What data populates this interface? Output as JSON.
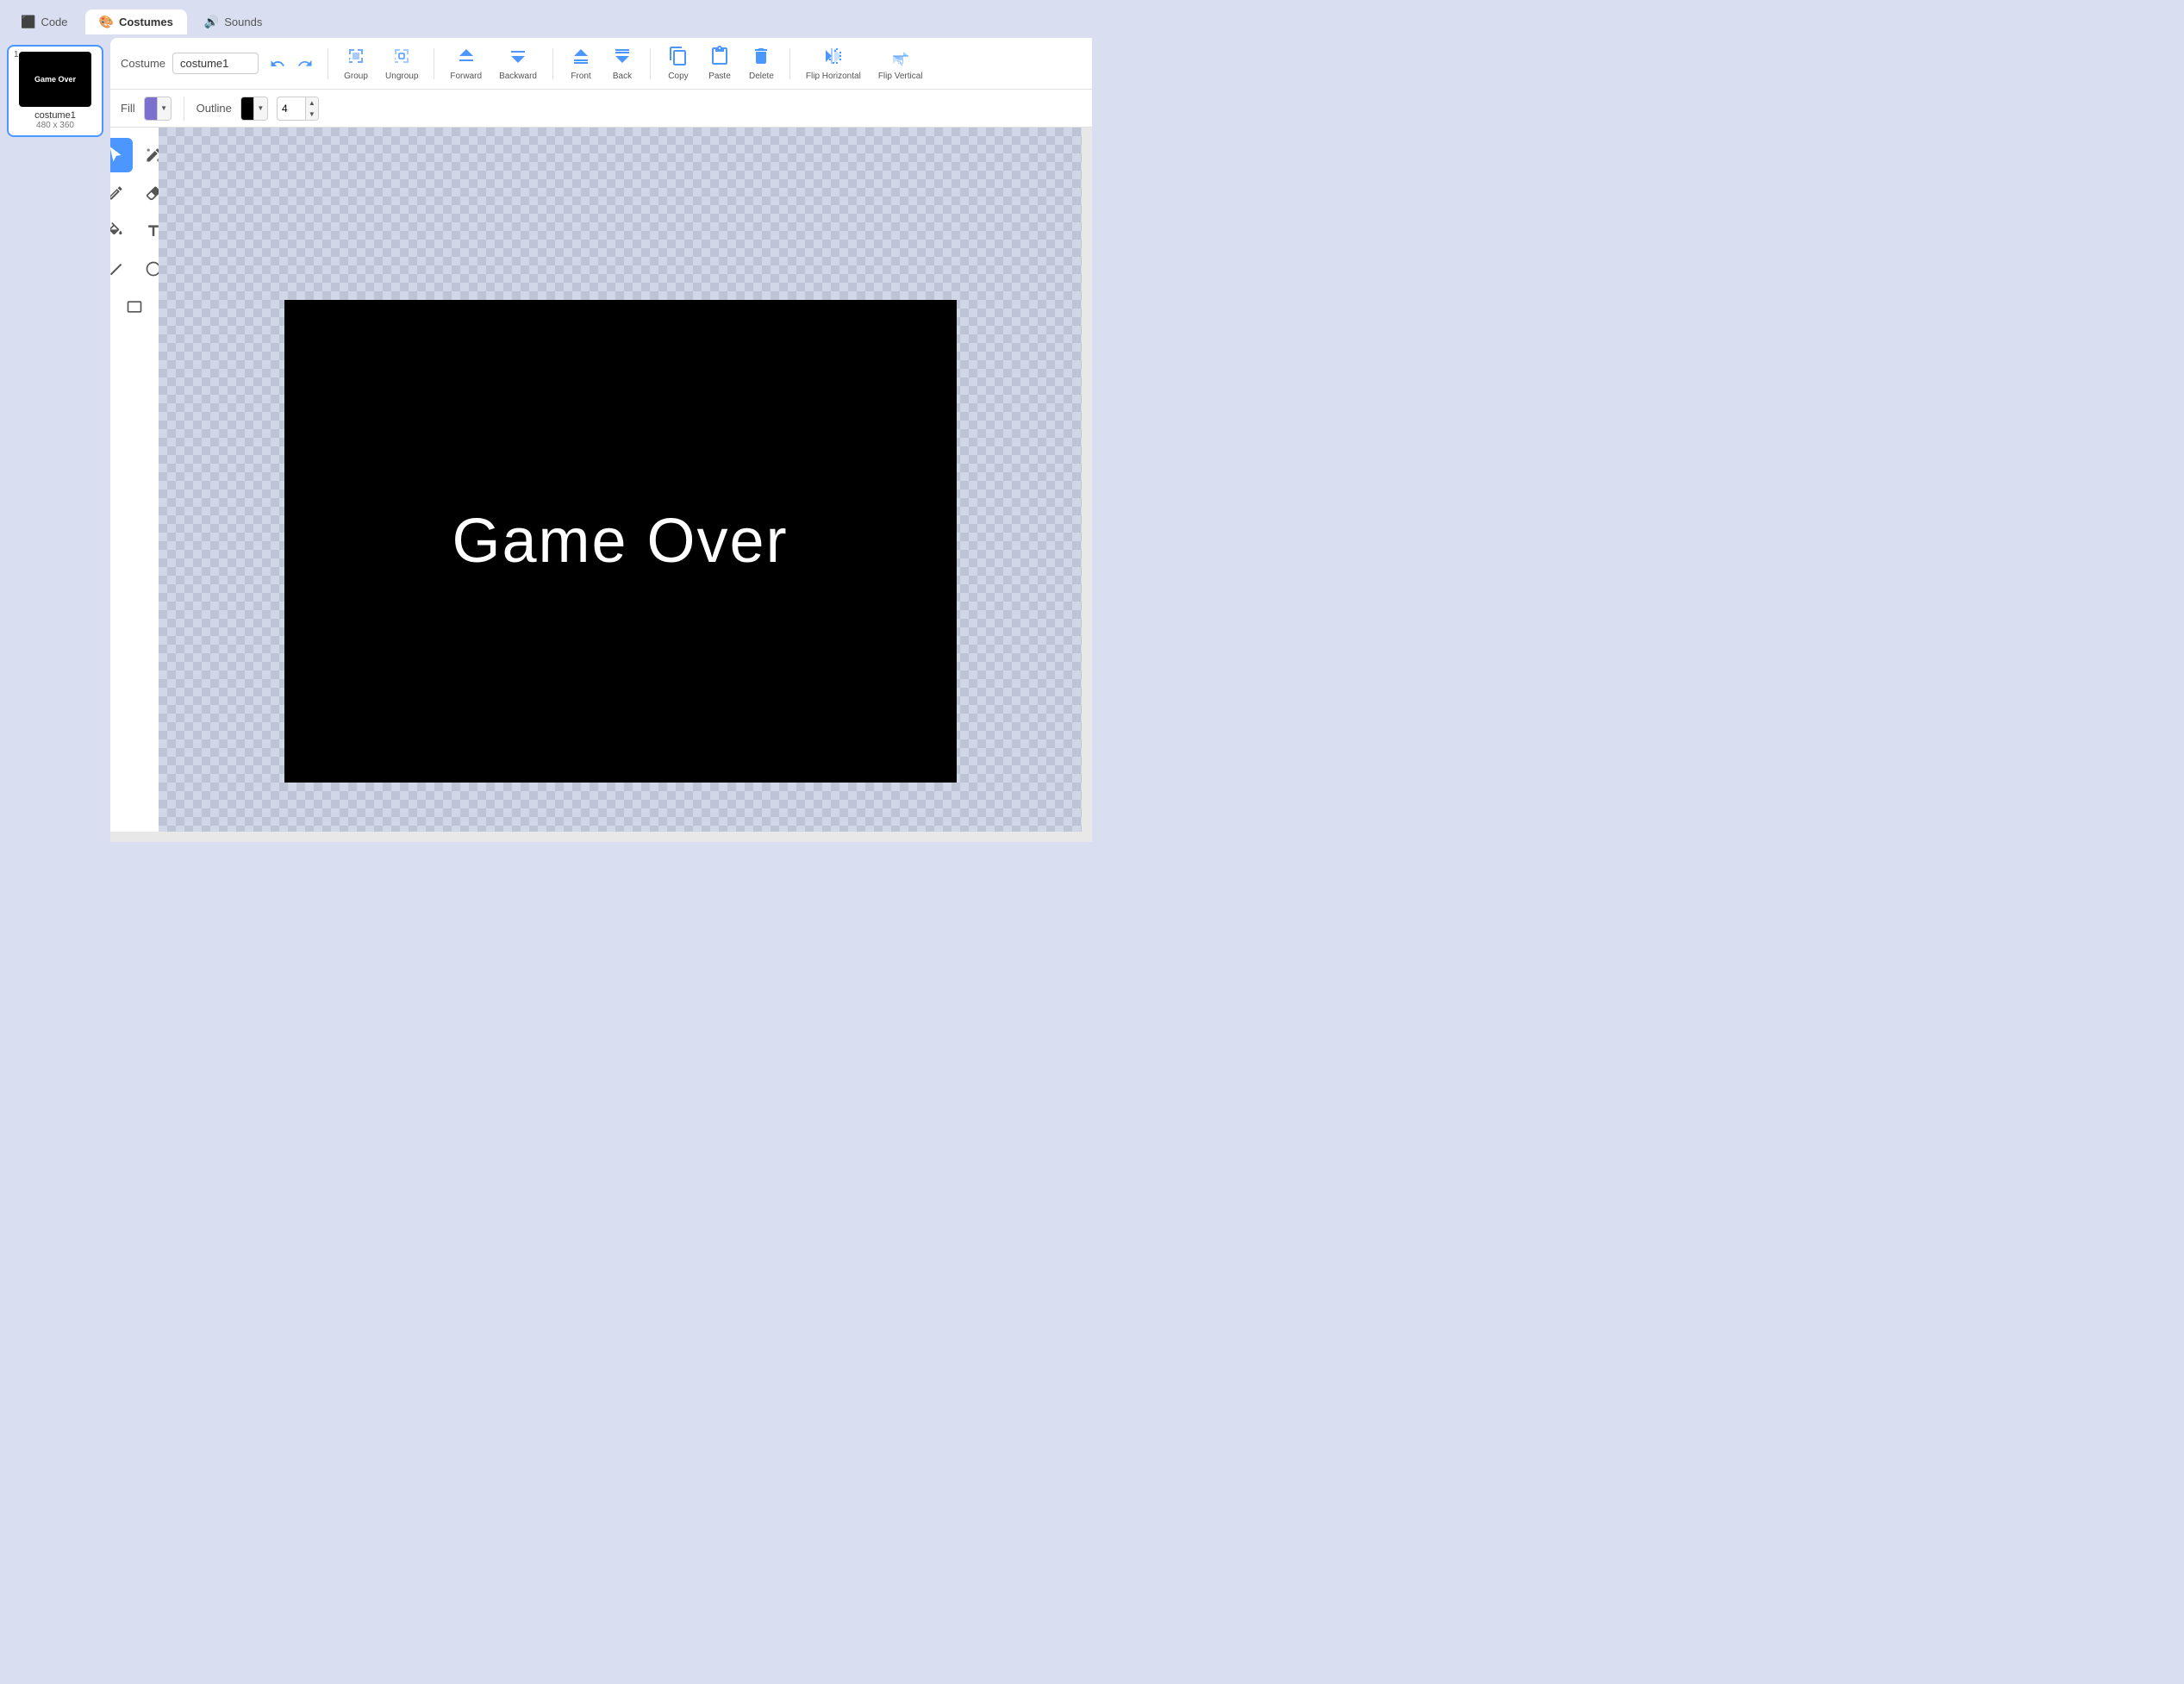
{
  "tabs": [
    {
      "id": "code",
      "label": "Code",
      "icon": "💻",
      "active": false
    },
    {
      "id": "costumes",
      "label": "Costumes",
      "icon": "🎨",
      "active": true
    },
    {
      "id": "sounds",
      "label": "Sounds",
      "icon": "🔊",
      "active": false
    }
  ],
  "costume_panel": {
    "items": [
      {
        "number": "1",
        "name": "costume1",
        "size": "480 x 360",
        "preview_text": "Game Over"
      }
    ]
  },
  "toolbar": {
    "costume_label": "Costume",
    "costume_name": "costume1",
    "undo_label": "↩",
    "redo_label": "↪",
    "group_label": "Group",
    "ungroup_label": "Ungroup",
    "forward_label": "Forward",
    "backward_label": "Backward",
    "front_label": "Front",
    "back_label": "Back",
    "copy_label": "Copy",
    "paste_label": "Paste",
    "delete_label": "Delete",
    "flip_h_label": "Flip Horizontal",
    "flip_v_label": "Flip Vertical"
  },
  "fill_row": {
    "fill_label": "Fill",
    "fill_color": "#7c6fcd",
    "outline_label": "Outline",
    "outline_color": "#000000",
    "outline_value": "4"
  },
  "tools": [
    {
      "id": "select",
      "icon": "cursor",
      "active": true
    },
    {
      "id": "reshape",
      "icon": "reshape",
      "active": false
    },
    {
      "id": "pencil",
      "icon": "pencil",
      "active": false
    },
    {
      "id": "eraser",
      "icon": "eraser",
      "active": false
    },
    {
      "id": "fill",
      "icon": "fill",
      "active": false
    },
    {
      "id": "text",
      "icon": "text",
      "active": false
    },
    {
      "id": "line",
      "icon": "line",
      "active": false
    },
    {
      "id": "circle",
      "icon": "circle",
      "active": false
    },
    {
      "id": "rect",
      "icon": "rect",
      "active": false
    }
  ],
  "canvas": {
    "game_over_text": "Game Over"
  }
}
